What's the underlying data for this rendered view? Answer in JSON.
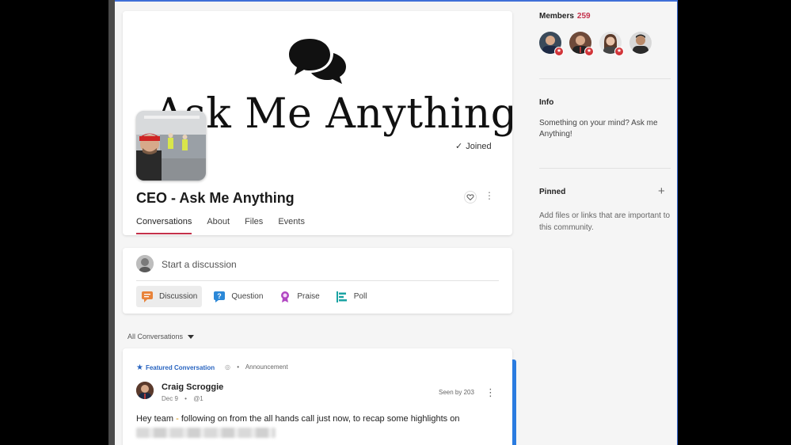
{
  "community": {
    "banner_text": "Ask Me Anything",
    "name": "CEO - Ask Me Anything",
    "joined_label": "Joined",
    "tabs": [
      {
        "label": "Conversations",
        "active": true
      },
      {
        "label": "About",
        "active": false
      },
      {
        "label": "Files",
        "active": false
      },
      {
        "label": "Events",
        "active": false
      }
    ]
  },
  "composer": {
    "placeholder": "Start a discussion",
    "post_types": [
      {
        "label": "Discussion",
        "icon": "discussion-icon",
        "color": "#e8833a"
      },
      {
        "label": "Question",
        "icon": "question-icon",
        "color": "#2b88d8"
      },
      {
        "label": "Praise",
        "icon": "praise-icon",
        "color": "#b146c2"
      },
      {
        "label": "Poll",
        "icon": "poll-icon",
        "color": "#1aa3a3"
      }
    ]
  },
  "feed": {
    "filter_label": "All Conversations",
    "post": {
      "featured_label": "Featured Conversation",
      "type_label": "Announcement",
      "author": "Craig Scroggie",
      "date": "Dec 9",
      "mentions": "@1",
      "seen_by": "Seen by 203",
      "body_start": "Hey team ",
      "body_dash": "-",
      "body_end": " following on from the all hands call just now, to recap some highlights on"
    }
  },
  "sidebar": {
    "members_label": "Members",
    "members_count": "259",
    "info_title": "Info",
    "info_text": "Something on your mind? Ask me Anything!",
    "pinned_title": "Pinned",
    "pinned_text": "Add files or links that are important to this community."
  },
  "colors": {
    "accent_red": "#c4314b",
    "featured_blue": "#2864c0",
    "frame_blue": "#3f6fd8"
  }
}
